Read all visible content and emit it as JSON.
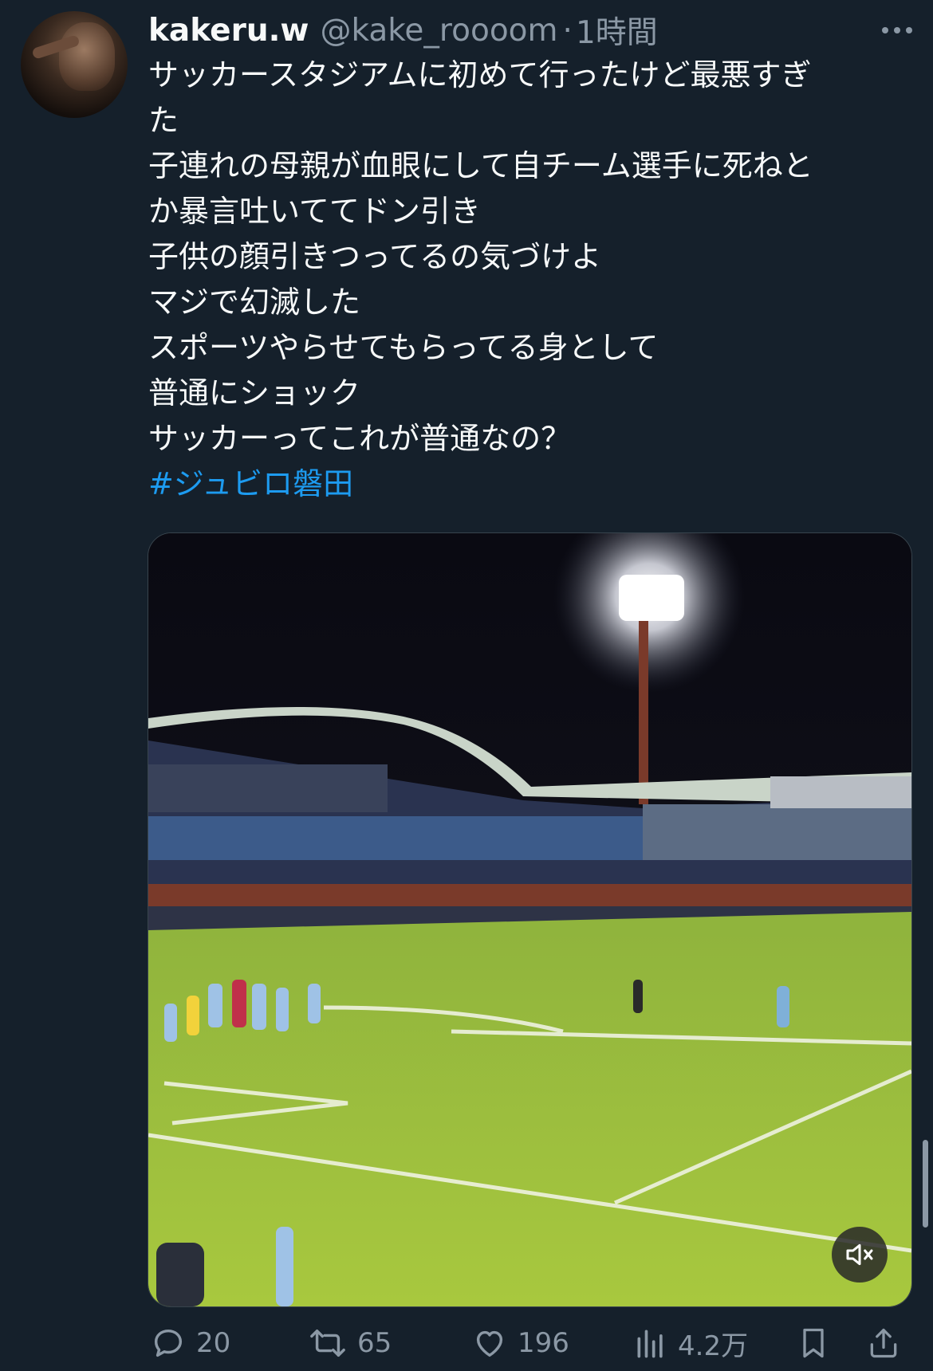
{
  "tweet": {
    "display_name": "kakeru.w",
    "handle": "@kake_roooom",
    "separator": "·",
    "time": "1時間",
    "text_lines": [
      "サッカースタジアムに初めて行ったけど最悪すぎ",
      "た",
      "子連れの母親が血眼にして自チーム選手に死ねと",
      "か暴言吐いててドン引き",
      "子供の顔引きつってるの気づけよ",
      "マジで幻滅した",
      "スポーツやらせてもらってる身として",
      "普通にショック",
      "サッカーってこれが普通なの？"
    ],
    "hashtag": "#ジュビロ磐田"
  },
  "media": {
    "type": "video",
    "description_icon": "mute-icon"
  },
  "actions": {
    "reply": {
      "icon": "reply-icon",
      "count": "20"
    },
    "retweet": {
      "icon": "retweet-icon",
      "count": "65"
    },
    "like": {
      "icon": "like-icon",
      "count": "196"
    },
    "views": {
      "icon": "views-icon",
      "count": "4.2万"
    },
    "bookmark": {
      "icon": "bookmark-icon"
    },
    "share": {
      "icon": "share-icon"
    }
  },
  "colors": {
    "background": "#15202b",
    "text": "#f7f9f9",
    "secondary": "#8b98a5",
    "link": "#1d9bf0"
  }
}
